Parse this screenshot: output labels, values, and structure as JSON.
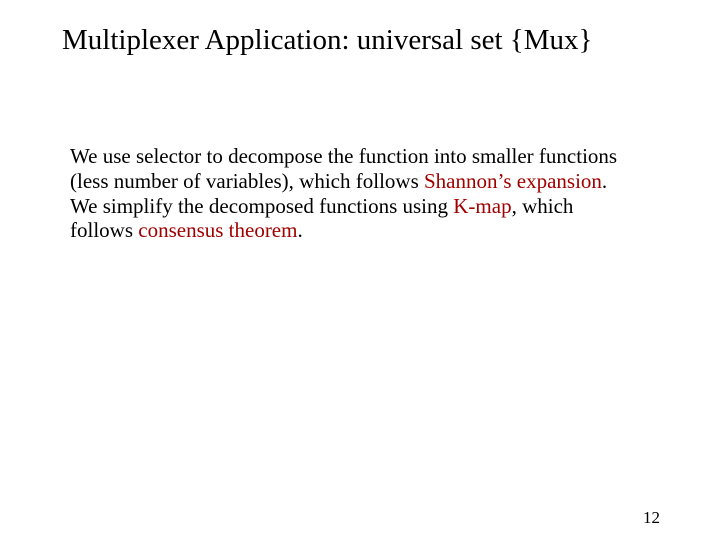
{
  "title": "Multiplexer Application: universal set {Mux}",
  "body": {
    "seg1": "We use selector to decompose the function into smaller functions (less number of variables), which follows ",
    "shannon": "Shannon’s expansion",
    "seg2": ".",
    "seg3": "We simplify the decomposed functions using ",
    "kmap": "K-map",
    "seg4": ", which follows ",
    "consensus": "consensus theorem",
    "seg5": "."
  },
  "page_number": "12"
}
